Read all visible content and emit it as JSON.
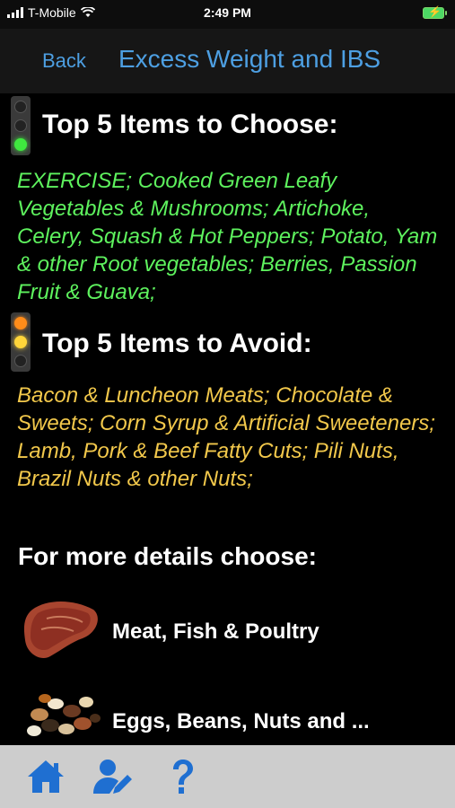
{
  "status_bar": {
    "carrier": "T-Mobile",
    "time": "2:49 PM"
  },
  "nav": {
    "back_label": "Back",
    "title": "Excess Weight and IBS"
  },
  "choose": {
    "heading": "Top 5 Items to Choose:",
    "items": "EXERCISE; Cooked Green Leafy Vegetables & Mushrooms; Artichoke, Celery, Squash & Hot Peppers; Potato, Yam & other Root vegetables; Berries, Passion Fruit & Guava;",
    "color": "#5ef25e",
    "icon": "green-traffic-light-icon"
  },
  "avoid": {
    "heading": "Top 5 Items to Avoid:",
    "items": "Bacon & Luncheon Meats;  Chocolate & Sweets;  Corn Syrup & Artificial Sweeteners; Lamb, Pork & Beef Fatty Cuts; Pili Nuts, Brazil Nuts & other Nuts;",
    "color": "#f2c84b",
    "icon": "yellow-traffic-light-icon"
  },
  "details": {
    "heading": "For more details choose:",
    "categories": [
      {
        "label": "Meat, Fish & Poultry",
        "icon": "steak-icon"
      },
      {
        "label": "Eggs, Beans, Nuts and ...",
        "icon": "beans-nuts-icon"
      }
    ]
  },
  "tab_bar": {
    "items": [
      {
        "icon": "home-icon"
      },
      {
        "icon": "user-edit-icon"
      },
      {
        "icon": "help-icon"
      }
    ]
  },
  "colors": {
    "accent": "#4d9fe2",
    "background": "#000000",
    "tab_bar": "#cdcdcd"
  }
}
